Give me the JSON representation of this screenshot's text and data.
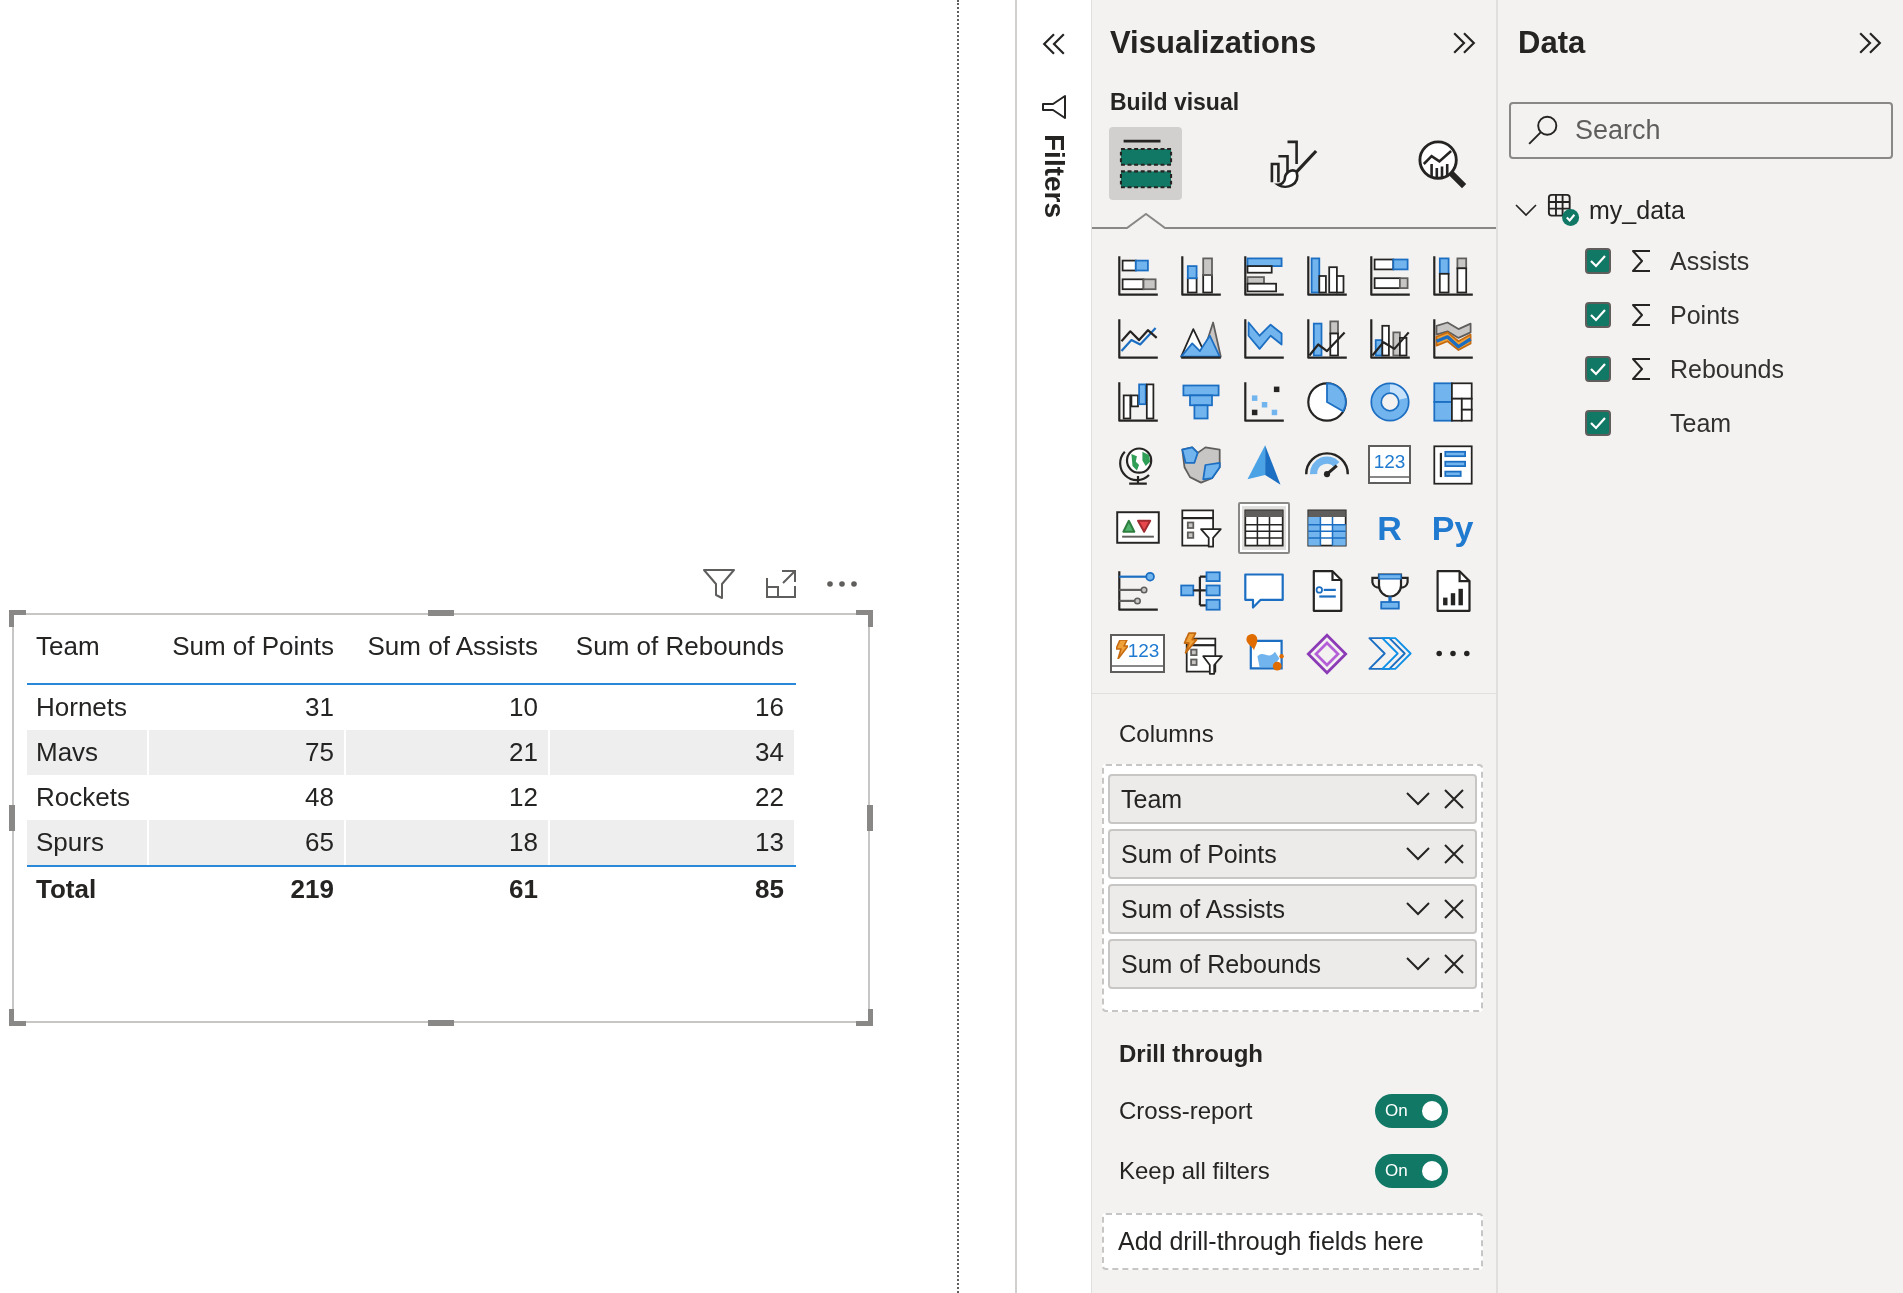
{
  "report_canvas": {
    "table_visual": {
      "columns": [
        "Team",
        "Sum of Points",
        "Sum of Assists",
        "Sum of Rebounds"
      ],
      "rows": [
        [
          "Hornets",
          "31",
          "10",
          "16"
        ],
        [
          "Mavs",
          "75",
          "21",
          "34"
        ],
        [
          "Rockets",
          "48",
          "12",
          "22"
        ],
        [
          "Spurs",
          "65",
          "18",
          "13"
        ]
      ],
      "total": [
        "Total",
        "219",
        "61",
        "85"
      ]
    }
  },
  "filters_pane": {
    "title": "Filters"
  },
  "visualizations": {
    "title": "Visualizations",
    "subtitle": "Build visual",
    "modes": [
      {
        "kind": "build",
        "selected": true
      },
      {
        "kind": "format",
        "selected": false
      },
      {
        "kind": "analytics",
        "selected": false
      }
    ],
    "gallery": [
      {
        "kind": "stacked-bar",
        "selected": false
      },
      {
        "kind": "stacked-column",
        "selected": false
      },
      {
        "kind": "clustered-bar",
        "selected": false
      },
      {
        "kind": "clustered-column",
        "selected": false
      },
      {
        "kind": "hundred-bar",
        "selected": false
      },
      {
        "kind": "hundred-column",
        "selected": false
      },
      {
        "kind": "line",
        "selected": false
      },
      {
        "kind": "area",
        "selected": false
      },
      {
        "kind": "stacked-area",
        "selected": false
      },
      {
        "kind": "line-stacked-column",
        "selected": false
      },
      {
        "kind": "line-clustered-column",
        "selected": false
      },
      {
        "kind": "ribbon",
        "selected": false
      },
      {
        "kind": "waterfall",
        "selected": false
      },
      {
        "kind": "funnel",
        "selected": false
      },
      {
        "kind": "scatter",
        "selected": false
      },
      {
        "kind": "pie",
        "selected": false
      },
      {
        "kind": "donut",
        "selected": false
      },
      {
        "kind": "treemap",
        "selected": false
      },
      {
        "kind": "globe",
        "selected": false
      },
      {
        "kind": "filled-map",
        "selected": false
      },
      {
        "kind": "azure-map",
        "selected": false
      },
      {
        "kind": "gauge",
        "selected": false
      },
      {
        "kind": "card",
        "label": "123",
        "selected": false
      },
      {
        "kind": "multi-row-card",
        "selected": false
      },
      {
        "kind": "kpi",
        "selected": false
      },
      {
        "kind": "slicer",
        "selected": false
      },
      {
        "kind": "table",
        "selected": true
      },
      {
        "kind": "matrix",
        "selected": false
      },
      {
        "kind": "script",
        "label": "R",
        "selected": false
      },
      {
        "kind": "script",
        "label": "Py",
        "selected": false
      },
      {
        "kind": "key-influencers",
        "selected": false
      },
      {
        "kind": "decomposition",
        "selected": false
      },
      {
        "kind": "qa",
        "selected": false
      },
      {
        "kind": "smart-narrative",
        "selected": false
      },
      {
        "kind": "metrics",
        "selected": false
      },
      {
        "kind": "paginated",
        "selected": false
      },
      {
        "kind": "lightning-card",
        "label": "123",
        "selected": false
      },
      {
        "kind": "lightning-slicer",
        "selected": false
      },
      {
        "kind": "arcgis",
        "selected": false
      },
      {
        "kind": "power-apps",
        "selected": false
      },
      {
        "kind": "power-automate",
        "selected": false
      },
      {
        "kind": "more",
        "selected": false
      }
    ],
    "columns_well": {
      "title": "Columns",
      "fields": [
        "Team",
        "Sum of Points",
        "Sum of Assists",
        "Sum of Rebounds"
      ]
    },
    "drill_through": {
      "title": "Drill through",
      "toggles": [
        {
          "label": "Cross-report",
          "on": true,
          "state_text": "On"
        },
        {
          "label": "Keep all filters",
          "on": true,
          "state_text": "On"
        }
      ],
      "drop_zone": "Add drill-through fields here"
    }
  },
  "data_pane": {
    "title": "Data",
    "search": {
      "placeholder": "Search"
    },
    "tables": [
      {
        "name": "my_data",
        "expanded": true,
        "children": [
          {
            "name": "Assists",
            "kind": "measure",
            "checked": true
          },
          {
            "name": "Points",
            "kind": "measure",
            "checked": true
          },
          {
            "name": "Rebounds",
            "kind": "measure",
            "checked": true
          },
          {
            "name": "Team",
            "kind": "column",
            "checked": true
          }
        ]
      }
    ]
  }
}
